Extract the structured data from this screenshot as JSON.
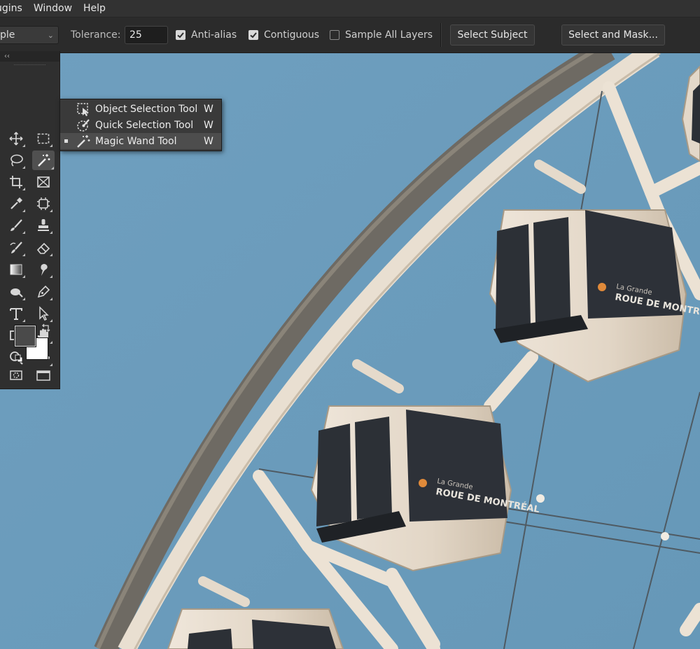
{
  "menubar": {
    "items": [
      "ugins",
      "Window",
      "Help"
    ]
  },
  "options": {
    "sample_value": "ple",
    "tolerance_label": "Tolerance:",
    "tolerance_value": "25",
    "anti_alias_label": "Anti-alias",
    "anti_alias_checked": true,
    "contiguous_label": "Contiguous",
    "contiguous_checked": true,
    "sample_all_layers_label": "Sample All Layers",
    "sample_all_layers_checked": false,
    "select_subject_label": "Select Subject",
    "select_and_mask_label": "Select and Mask..."
  },
  "toolbar": {
    "collapse_glyph": "‹‹",
    "active_tool": "magic-wand-tool",
    "foreground_color": "#4a4a4a",
    "background_color": "#ffffff"
  },
  "flyout": {
    "items": [
      {
        "label": "Object Selection Tool",
        "shortcut": "W",
        "icon": "object-selection-icon",
        "active": false
      },
      {
        "label": "Quick Selection Tool",
        "shortcut": "W",
        "icon": "quick-selection-icon",
        "active": false
      },
      {
        "label": "Magic Wand Tool",
        "shortcut": "W",
        "icon": "magic-wand-icon",
        "active": true
      }
    ]
  },
  "photo": {
    "gondola_sign_small": "La Grande",
    "gondola_sign_large": "ROUE DE MONTRÉAL",
    "sky_color": "#6b9cbc"
  }
}
